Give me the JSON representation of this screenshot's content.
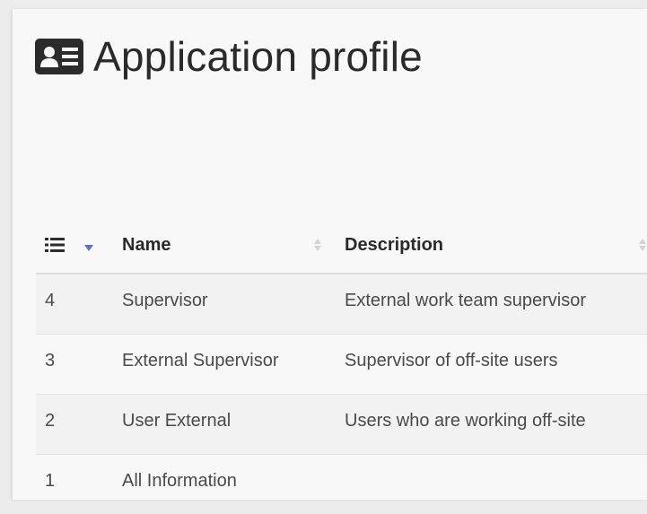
{
  "page": {
    "title": "Application profile",
    "title_icon": "id-card-icon"
  },
  "table": {
    "columns": [
      {
        "key": "id",
        "label": "",
        "icon": "list-icon",
        "sort": "descending"
      },
      {
        "key": "name",
        "label": "Name",
        "sort": "none"
      },
      {
        "key": "description",
        "label": "Description",
        "sort": "none"
      }
    ],
    "rows": [
      {
        "id": "4",
        "name": "Supervisor",
        "description": "External work team supervisor"
      },
      {
        "id": "3",
        "name": "External Supervisor",
        "description": "Supervisor of off-site users"
      },
      {
        "id": "2",
        "name": "User External",
        "description": "Users who are working off-site"
      },
      {
        "id": "1",
        "name": "All Information",
        "description": ""
      }
    ]
  },
  "colors": {
    "sort_active": "#5b6fc7",
    "sort_inactive": "#c8c8c8",
    "text": "#2a2a2a"
  }
}
